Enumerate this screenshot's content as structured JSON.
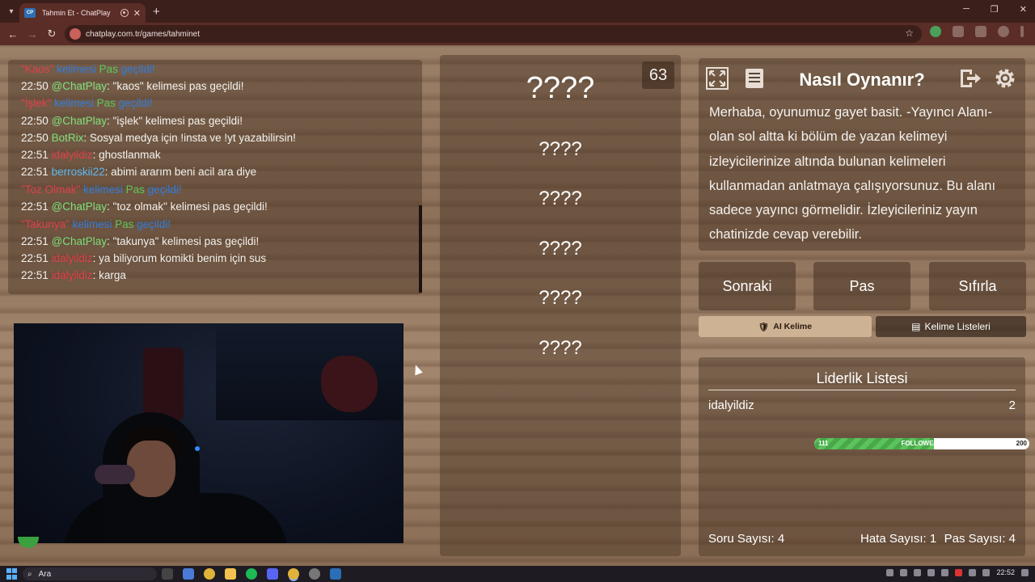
{
  "browser": {
    "tab_title": "Tahmin Et - ChatPlay",
    "favicon_text": "CP",
    "url": "chatplay.com.tr/games/tahminet"
  },
  "chat": {
    "lines": [
      {
        "time": "",
        "user": "\"Kaos\"",
        "text": "",
        "system": true,
        "kw1": " kelimesi ",
        "kw2": "Pas",
        "kw3": " geçildi!"
      },
      {
        "time": "22:50",
        "user": "@ChatPlay",
        "text": ": \"kaos\" kelimesi pas geçildi!"
      },
      {
        "time": "",
        "user": "\"İşlek\"",
        "system": true,
        "kw1": " kelimesi ",
        "kw2": "Pas",
        "kw3": " geçildi!"
      },
      {
        "time": "22:50",
        "user": "@ChatPlay",
        "text": ": \"işlek\" kelimesi pas geçildi!"
      },
      {
        "time": "22:50",
        "user": "BotRix",
        "text": ": Sosyal medya için !insta ve !yt yazabilirsin!"
      },
      {
        "time": "22:51",
        "user": "idalyildiz",
        "text": ": ghostlanmak"
      },
      {
        "time": "22:51",
        "user": "berroskii22",
        "text": ": abimi ararım beni acil ara diye"
      },
      {
        "time": "",
        "user": "\"Toz Olmak\"",
        "system": true,
        "kw1": " kelimesi ",
        "kw2": "Pas",
        "kw3": " geçildi!"
      },
      {
        "time": "22:51",
        "user": "@ChatPlay",
        "text": ": \"toz olmak\" kelimesi pas geçildi!"
      },
      {
        "time": "",
        "user": "\"Takunya\"",
        "system": true,
        "kw1": " kelimesi ",
        "kw2": "Pas",
        "kw3": " geçildi!"
      },
      {
        "time": "22:51",
        "user": "@ChatPlay",
        "text": ": \"takunya\" kelimesi pas geçildi!"
      },
      {
        "time": "22:51",
        "user": "idalyildiz",
        "text": ": ya biliyorum komikti benim için sus"
      },
      {
        "time": "22:51",
        "user": "idalyildiz",
        "text": ": karga"
      }
    ]
  },
  "words": {
    "round_number": "63",
    "main": "????",
    "items": [
      "????",
      "????",
      "????",
      "????",
      "????"
    ]
  },
  "howto": {
    "title": "Nasıl Oynanır?",
    "description": "Merhaba, oyunumuz gayet basit. -Yayıncı Alanı- olan sol altta ki bölüm de yazan kelimeyi izleyicilerinize altında bulunan kelimeleri kullanmadan anlatmaya çalışıyorsunuz. Bu alanı sadece yayıncı görmelidir. İzleyicileriniz yayın chatinizde cevap verebilir."
  },
  "controls": {
    "next": "Sonraki",
    "pass": "Pas",
    "reset": "Sıfırla",
    "ai_word": "AI Kelime",
    "word_lists": "Kelime Listeleri"
  },
  "leaderboard": {
    "title": "Liderlik Listesi",
    "rows": [
      {
        "name": "idalyildiz",
        "score": "2"
      }
    ],
    "followers": {
      "label": "FOLLOWERS",
      "current": "111",
      "goal": "200",
      "progress": 0.555
    },
    "questions": "Soru Sayısı: 4",
    "errors": "Hata Sayısı: 1",
    "passes": "Pas Sayısı: 4"
  },
  "taskbar": {
    "search": "Ara",
    "time": "22:52"
  }
}
